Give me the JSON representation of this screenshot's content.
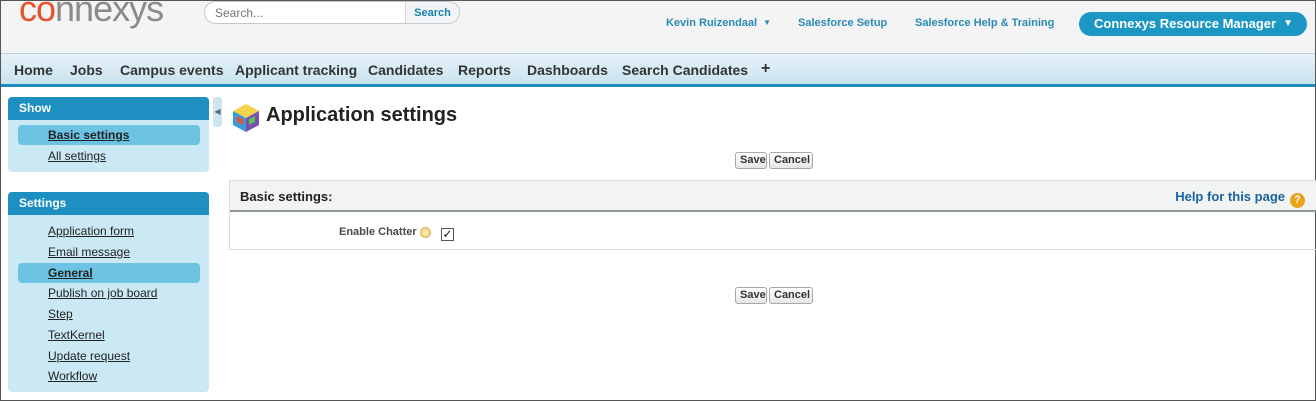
{
  "header": {
    "logo": {
      "prefix": "co",
      "rest": "nnexys"
    },
    "search": {
      "placeholder": "Search...",
      "button_label": "Search"
    },
    "user_menu_label": "Kevin Ruizendaal",
    "setup_link": "Salesforce Setup",
    "help_link": "Salesforce Help & Training",
    "app_switcher_label": "Connexys Resource Manager"
  },
  "tabs": [
    "Home",
    "Jobs",
    "Campus events",
    "Applicant tracking",
    "Candidates",
    "Reports",
    "Dashboards",
    "Search Candidates",
    "+"
  ],
  "sidebar": {
    "show": {
      "title": "Show",
      "items": [
        {
          "label": "Basic settings",
          "active": true
        },
        {
          "label": "All settings",
          "active": false
        }
      ]
    },
    "settings": {
      "title": "Settings",
      "items": [
        {
          "label": "Application form",
          "active": false
        },
        {
          "label": "Email message",
          "active": false
        },
        {
          "label": "General",
          "active": true
        },
        {
          "label": "Publish on job board",
          "active": false
        },
        {
          "label": "Step",
          "active": false
        },
        {
          "label": "TextKernel",
          "active": false
        },
        {
          "label": "Update request",
          "active": false
        },
        {
          "label": "Workflow",
          "active": false
        }
      ]
    }
  },
  "main": {
    "page_title": "Application settings",
    "save_label": "Save",
    "cancel_label": "Cancel",
    "section": {
      "title": "Basic settings:",
      "help_link": "Help for this page",
      "help_icon_glyph": "?",
      "fields": [
        {
          "label": "Enable Chatter",
          "checked": true,
          "check_glyph": "✓"
        }
      ]
    }
  },
  "colors": {
    "brand_orange": "#e8522a",
    "accent_blue": "#1d8fc1",
    "sidebar_bg": "#cbe9f5",
    "sidebar_active": "#6cc3e4"
  }
}
